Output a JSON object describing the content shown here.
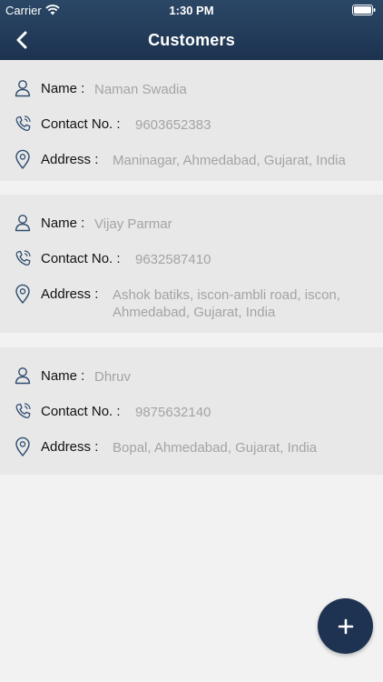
{
  "status_bar": {
    "carrier": "Carrier",
    "time": "1:30 PM"
  },
  "nav": {
    "title": "Customers"
  },
  "fields": {
    "name_label": "Name :",
    "contact_label": "Contact No. :",
    "address_label": "Address :"
  },
  "customers": [
    {
      "name": "Naman Swadia",
      "contact": "9603652383",
      "address": "Maninagar, Ahmedabad, Gujarat, India"
    },
    {
      "name": "Vijay Parmar",
      "contact": "9632587410",
      "address": "Ashok batiks, iscon-ambli road, iscon, Ahmedabad, Gujarat, India"
    },
    {
      "name": "Dhruv",
      "contact": "9875632140",
      "address": "Bopal, Ahmedabad, Gujarat, India"
    }
  ],
  "colors": {
    "header": "#1c3350",
    "fab": "#1e3351",
    "card": "#e8e8e8",
    "value_text": "#a4a4a4"
  },
  "icons": {
    "back": "chevron-left-icon",
    "name": "user-icon",
    "contact": "phone-icon",
    "address": "location-pin-icon",
    "add": "plus-icon"
  }
}
